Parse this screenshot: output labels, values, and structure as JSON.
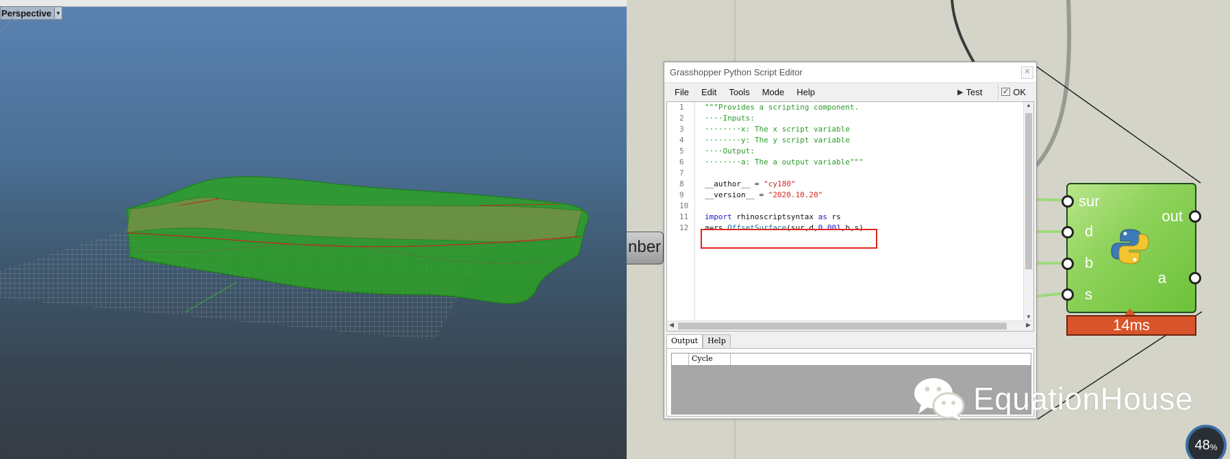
{
  "viewport": {
    "name": "Perspective",
    "dropdown_icon": "triangle-down-icon"
  },
  "canvas": {
    "slider_stub_text": "nber",
    "component": {
      "inputs": [
        "sur",
        "d",
        "b",
        "s"
      ],
      "outputs": [
        "out",
        "a"
      ],
      "icon": "python-logo-icon",
      "timing": "14ms",
      "colors": {
        "body": "#8fd25b",
        "timing": "#d9542a"
      }
    },
    "zoom": {
      "value": "48",
      "unit": "%"
    },
    "watermark": "EquationHouse"
  },
  "editor": {
    "title": "Grasshopper Python Script Editor",
    "menu": [
      "File",
      "Edit",
      "Tools",
      "Mode",
      "Help"
    ],
    "test_label": "Test",
    "ok_label": "OK",
    "line_numbers": [
      "1",
      "2",
      "3",
      "4",
      "5",
      "6",
      "7",
      "8",
      "9",
      "10",
      "11",
      "12"
    ],
    "code": {
      "l1": "\"\"\"Provides a scripting component.",
      "l2": "····Inputs:",
      "l3": "········x: The x script variable",
      "l4": "········y: The y script variable",
      "l5": "····Output:",
      "l6": "········a: The a output variable\"\"\"",
      "l8_a": "__author__ = ",
      "l8_b": "\"cy180\"",
      "l9_a": "__version__ = ",
      "l9_b": "\"2020.10.20\"",
      "l11_kw1": "import",
      "l11_mod": " rhinoscriptsyntax ",
      "l11_kw2": "as",
      "l11_alias": " rs",
      "l12_a": "a=rs.",
      "l12_fn": "OffsetSurface",
      "l12_b": "(sur,d,",
      "l12_num": "0.001",
      "l12_c": ",b,s)"
    },
    "output_tabs": [
      "Output",
      "Help"
    ],
    "output_column": "Cycle"
  }
}
